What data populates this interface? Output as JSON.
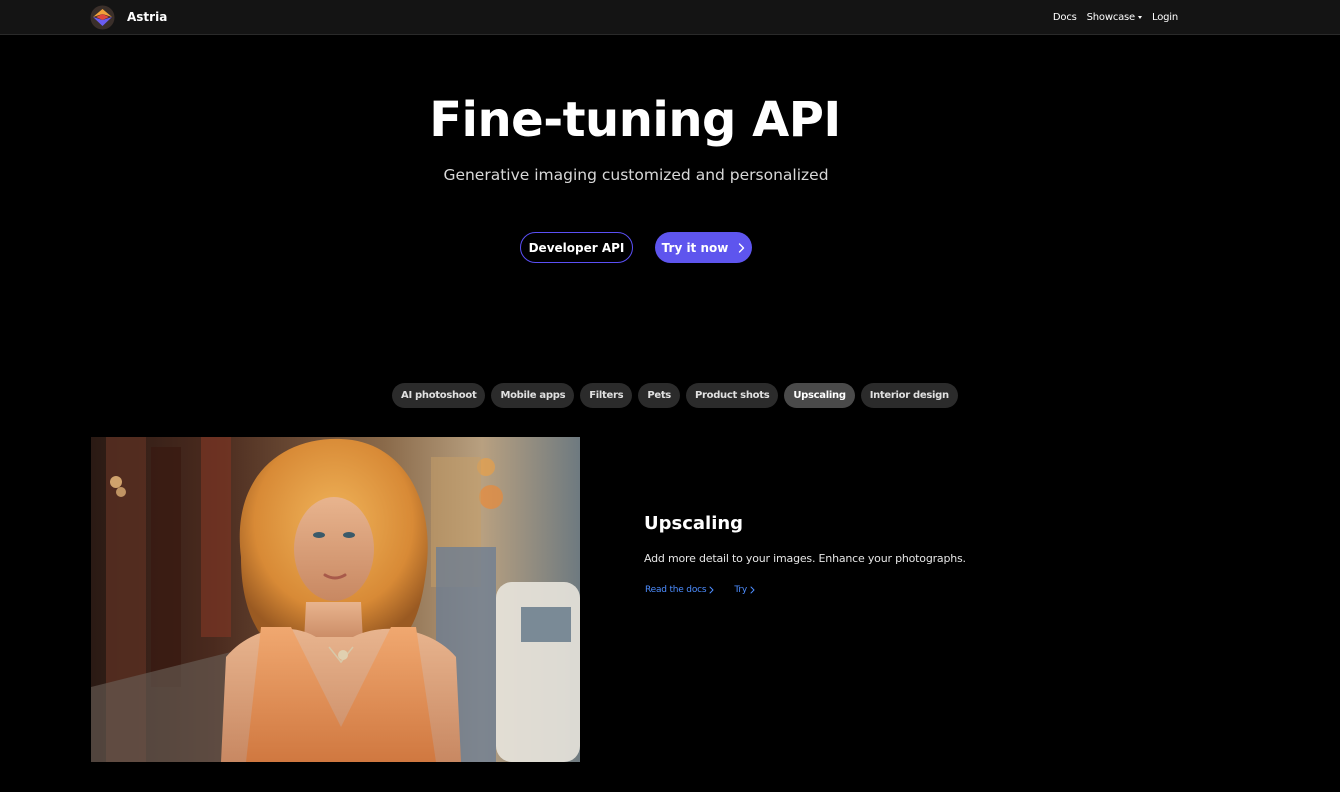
{
  "navbar": {
    "brand_name": "Astria",
    "links": {
      "docs": "Docs",
      "showcase": "Showcase",
      "login": "Login"
    }
  },
  "hero": {
    "title": "Fine-tuning API",
    "subtitle": "Generative imaging customized and personalized",
    "developer_api_label": "Developer API",
    "try_now_label": "Try it now"
  },
  "tabs": [
    {
      "label": "AI photoshoot",
      "active": false
    },
    {
      "label": "Mobile apps",
      "active": false
    },
    {
      "label": "Filters",
      "active": false
    },
    {
      "label": "Pets",
      "active": false
    },
    {
      "label": "Product shots",
      "active": false
    },
    {
      "label": "Upscaling",
      "active": true
    },
    {
      "label": "Interior design",
      "active": false
    }
  ],
  "feature": {
    "title": "Upscaling",
    "description": "Add more detail to your images. Enhance your photographs.",
    "read_docs_label": "Read the docs",
    "try_label": "Try"
  },
  "colors": {
    "background": "#000000",
    "navbar": "#141414",
    "accent": "#5e55ee",
    "link": "#4d8dff",
    "pill": "#2b2b2b",
    "pill_active": "#4a4a4a"
  }
}
